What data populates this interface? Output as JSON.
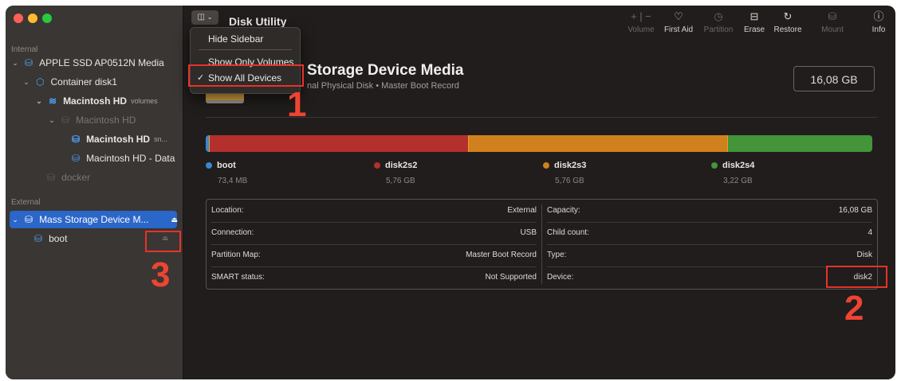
{
  "window": {
    "title": "Disk Utility"
  },
  "colors": {
    "boot": "#3d86cf",
    "disk2s2": "#b3302c",
    "disk2s3": "#d0801c",
    "disk2s4": "#44943a"
  },
  "sidebar": {
    "internal_label": "Internal",
    "external_label": "External",
    "items": [
      {
        "label": "APPLE SSD AP0512N Media",
        "sub": ""
      },
      {
        "label": "Container disk1",
        "sub": ""
      },
      {
        "label": "Macintosh HD",
        "sub": "volumes"
      },
      {
        "label": "Macintosh HD",
        "sub": ""
      },
      {
        "label": "Macintosh HD",
        "sub": "sn..."
      },
      {
        "label": "Macintosh HD - Data",
        "sub": ""
      },
      {
        "label": "docker",
        "sub": ""
      },
      {
        "label": "Mass Storage Device M...",
        "sub": ""
      },
      {
        "label": "boot",
        "sub": ""
      }
    ]
  },
  "toolbar": {
    "buttons": [
      {
        "label": "Volume",
        "icon": "plus-minus-icon"
      },
      {
        "label": "First Aid",
        "icon": "stethoscope-icon"
      },
      {
        "label": "Partition",
        "icon": "pie-icon"
      },
      {
        "label": "Erase",
        "icon": "erase-icon"
      },
      {
        "label": "Restore",
        "icon": "restore-icon"
      },
      {
        "label": "Mount",
        "icon": "mount-icon"
      },
      {
        "label": "Info",
        "icon": "info-icon"
      }
    ]
  },
  "menu": {
    "items": [
      "Hide Sidebar",
      "Show Only Volumes",
      "Show All Devices"
    ],
    "check": "✓"
  },
  "device": {
    "title": "Storage Device Media",
    "subtitle": "nal Physical Disk • Master Boot Record",
    "size": "16,08 GB"
  },
  "partitions": [
    {
      "name": "boot",
      "size": "73,4 MB",
      "size_gb": 0.0734
    },
    {
      "name": "disk2s2",
      "size": "5,76 GB",
      "size_gb": 5.76
    },
    {
      "name": "disk2s3",
      "size": "5,76 GB",
      "size_gb": 5.76
    },
    {
      "name": "disk2s4",
      "size": "3,22 GB",
      "size_gb": 3.22
    }
  ],
  "info": {
    "left": [
      {
        "k": "Location:",
        "v": "External"
      },
      {
        "k": "Connection:",
        "v": "USB"
      },
      {
        "k": "Partition Map:",
        "v": "Master Boot Record"
      },
      {
        "k": "SMART status:",
        "v": "Not Supported"
      }
    ],
    "right": [
      {
        "k": "Capacity:",
        "v": "16,08 GB"
      },
      {
        "k": "Child count:",
        "v": "4"
      },
      {
        "k": "Type:",
        "v": "Disk"
      },
      {
        "k": "Device:",
        "v": "disk2"
      }
    ]
  },
  "annotations": [
    "1",
    "2",
    "3"
  ]
}
